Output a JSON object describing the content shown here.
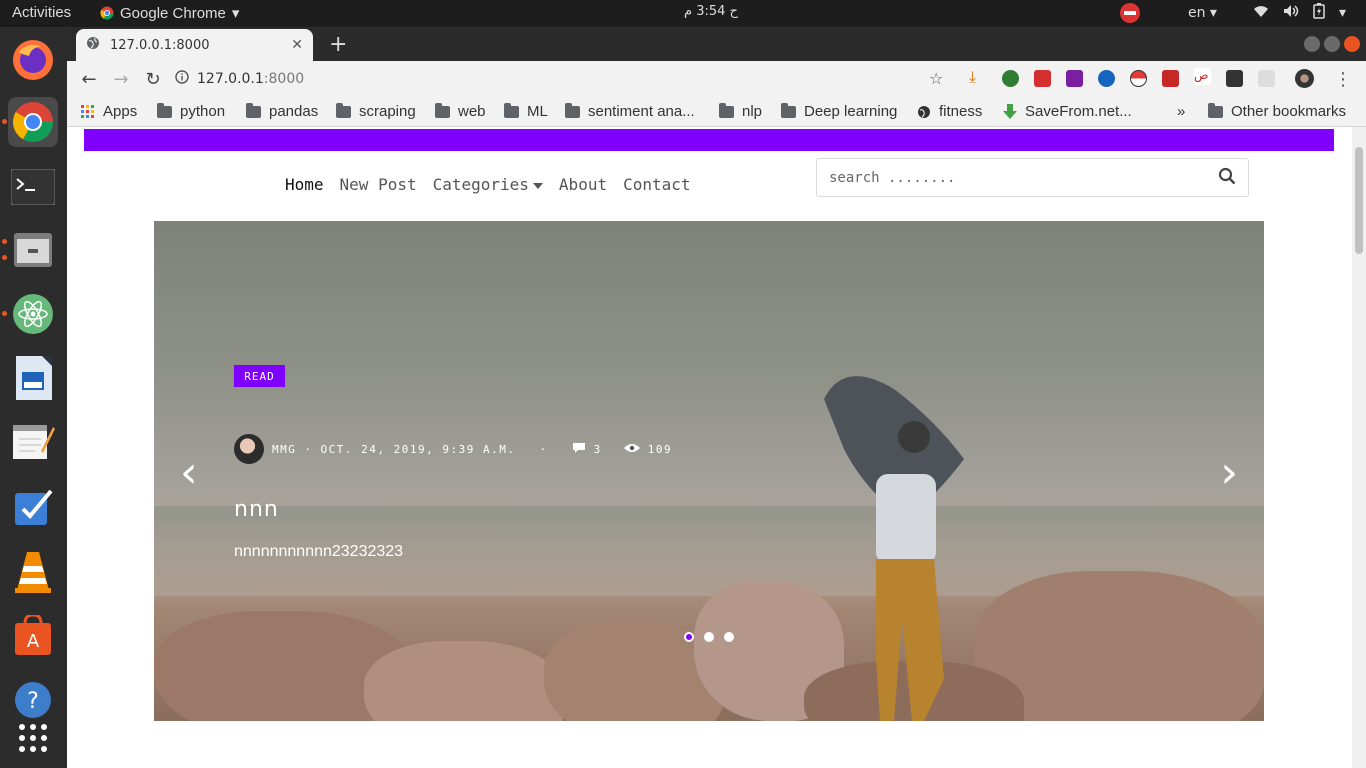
{
  "system": {
    "activities": "Activities",
    "app_name": "Google Chrome",
    "clock": "ح 3:54 م",
    "language": "en"
  },
  "dock": {
    "icons": [
      "firefox-icon",
      "chrome-icon",
      "terminal-icon",
      "files-icon",
      "atom-icon",
      "writer-icon",
      "text-editor-icon",
      "tasks-icon",
      "vlc-icon",
      "software-center-icon",
      "help-icon",
      "apps-grid-icon"
    ]
  },
  "browser": {
    "tab_title": "127.0.0.1:8000",
    "url_host": "127.0.0.1",
    "url_port": ":8000",
    "bookmarks": [
      "Apps",
      "python",
      "pandas",
      "scraping",
      "web",
      "ML",
      "sentiment ana...",
      "nlp",
      "Deep learning",
      "fitness",
      "SaveFrom.net...",
      "»",
      "Other bookmarks"
    ],
    "accent": "#8000ff"
  },
  "site": {
    "nav": [
      "Home",
      "New Post",
      "Categories",
      "About",
      "Contact"
    ],
    "search_placeholder": "search ........"
  },
  "hero": {
    "badge": "READ",
    "author": "MMG",
    "separator": "·",
    "date": "OCT. 24, 2019, 9:39 A.M.",
    "comments": "3",
    "views": "109",
    "title": "nnn",
    "description": "nnnnnnnnnnn23232323",
    "active_slide": 1,
    "slide_count": 3
  }
}
